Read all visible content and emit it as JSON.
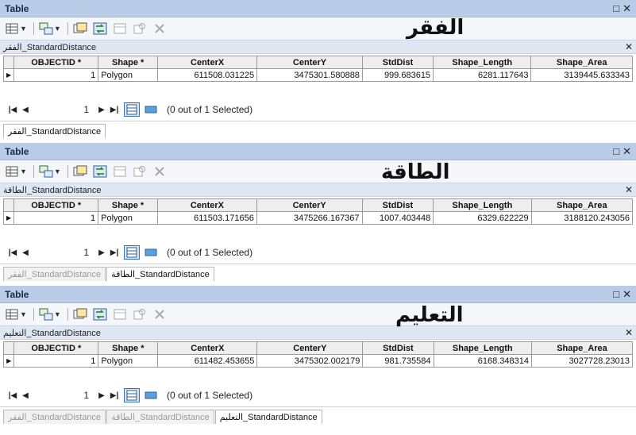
{
  "panels": [
    {
      "window_title": "Table",
      "arabic_title": "الفقر",
      "table_tab": "الفقر_StandardDistance",
      "columns": [
        "OBJECTID *",
        "Shape *",
        "CenterX",
        "CenterY",
        "StdDist",
        "Shape_Length",
        "Shape_Area"
      ],
      "row": [
        "1",
        "Polygon",
        "611508.031225",
        "3475301.580888",
        "999.683615",
        "6281.117643",
        "3139445.633343"
      ],
      "record": "1",
      "selection": "(0 out of 1 Selected)",
      "bottom_tabs": [
        {
          "label": "الفقر_StandardDistance",
          "active": true
        }
      ]
    },
    {
      "window_title": "Table",
      "arabic_title": "الطاقة",
      "table_tab": "الطاقة_StandardDistance",
      "columns": [
        "OBJECTID *",
        "Shape *",
        "CenterX",
        "CenterY",
        "StdDist",
        "Shape_Length",
        "Shape_Area"
      ],
      "row": [
        "1",
        "Polygon",
        "611503.171656",
        "3475266.167367",
        "1007.403448",
        "6329.622229",
        "3188120.243056"
      ],
      "record": "1",
      "selection": "(0 out of 1 Selected)",
      "bottom_tabs": [
        {
          "label": "الفقر_StandardDistance",
          "active": false
        },
        {
          "label": "الطاقة_StandardDistance",
          "active": true
        }
      ]
    },
    {
      "window_title": "Table",
      "arabic_title": "التعليم",
      "table_tab": "التعليم_StandardDistance",
      "columns": [
        "OBJECTID *",
        "Shape *",
        "CenterX",
        "CenterY",
        "StdDist",
        "Shape_Length",
        "Shape_Area"
      ],
      "row": [
        "1",
        "Polygon",
        "611482.453655",
        "3475302.002179",
        "981.735584",
        "6168.348314",
        "3027728.23013"
      ],
      "record": "1",
      "selection": "(0 out of 1 Selected)",
      "bottom_tabs": [
        {
          "label": "الفقر_StandardDistance",
          "active": false
        },
        {
          "label": "الطاقة_StandardDistance",
          "active": false
        },
        {
          "label": "التعليم_StandardDistance",
          "active": true
        }
      ]
    }
  ],
  "icons": {
    "table-options": "table-options-icon",
    "related-tables": "related-tables-icon",
    "select-by-attributes": "select-by-attributes-icon",
    "switch-selection": "switch-selection-icon",
    "clear-selection": "clear-selection-icon",
    "zoom-to-selected": "zoom-to-selected-icon",
    "delete-selected": "delete-selected-icon"
  },
  "colors": {
    "titlebar": "#b9cde8",
    "tabstrip": "#dfe7f3",
    "accent": "#3a6fb5"
  }
}
